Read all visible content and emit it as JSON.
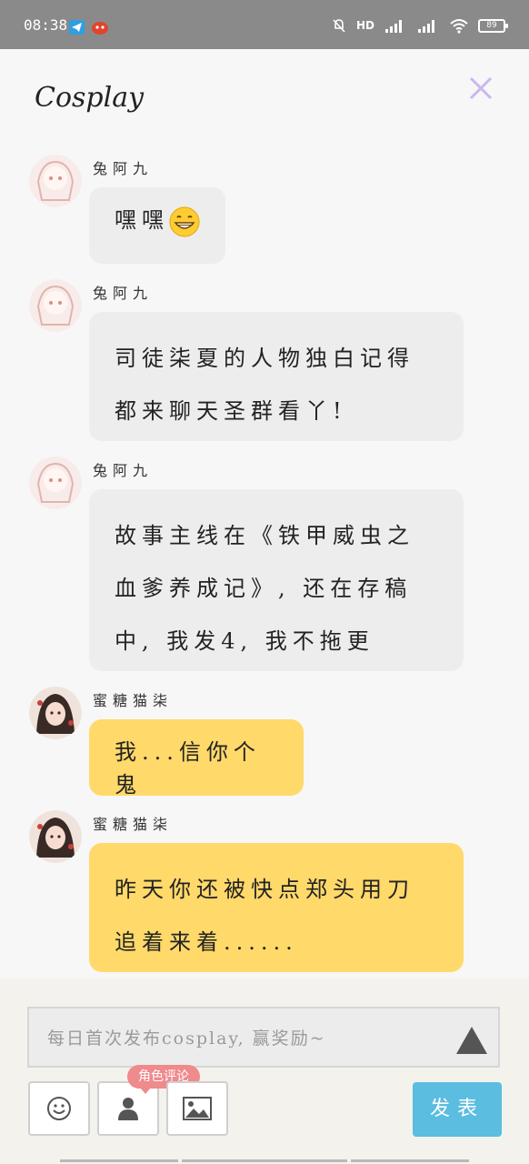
{
  "status_bar": {
    "time": "08:38",
    "net1": "HD",
    "net2": "4G⁺",
    "net3": "4G",
    "battery": "89"
  },
  "header": {
    "title": "Cosplay"
  },
  "messages": [
    {
      "user": "兔阿九",
      "text": "嘿嘿",
      "emoji": "grinning-face",
      "style": "grey"
    },
    {
      "user": "兔阿九",
      "lines": [
        "司徒柒夏的人物独白记得",
        "都来聊天圣群看丫!"
      ],
      "style": "grey"
    },
    {
      "user": "兔阿九",
      "lines": [
        "故事主线在《铁甲威虫之",
        "血爹养成记》, 还在存稿",
        "中, 我发4, 我不拖更"
      ],
      "style": "grey"
    },
    {
      "user": "蜜糖猫柒",
      "text": "我...信你个鬼",
      "style": "yellow"
    },
    {
      "user": "蜜糖猫柒",
      "lines": [
        "昨天你还被快点郑头用刀",
        "追着来着......"
      ],
      "style": "yellow"
    }
  ],
  "composer": {
    "placeholder": "每日首次发布cosplay, 赢奖励~",
    "role_tag": "角色评论",
    "send_label": "发表"
  },
  "colors": {
    "bubble_grey": "#ededed",
    "bubble_yellow": "#ffd96a",
    "send": "#5bbde0",
    "tag": "#ef8a8d",
    "close": "#c9b8ee"
  }
}
